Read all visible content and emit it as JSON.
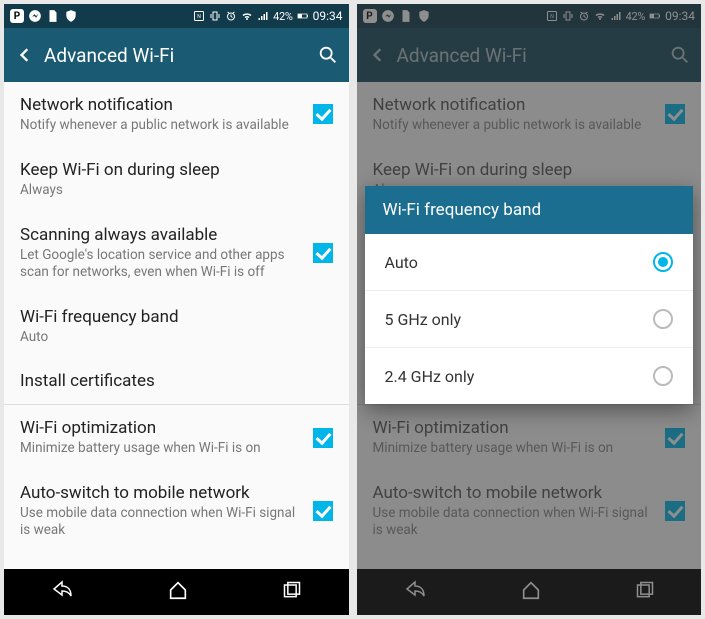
{
  "status": {
    "battery_pct": "42%",
    "time": "09:34"
  },
  "appbar": {
    "title": "Advanced Wi-Fi"
  },
  "settings": {
    "network_notification": {
      "title": "Network notification",
      "sub": "Notify whenever a public network is available"
    },
    "keep_on_sleep": {
      "title": "Keep Wi-Fi on during sleep",
      "sub": "Always"
    },
    "scanning": {
      "title": "Scanning always available",
      "sub": "Let Google's location service and other apps scan for networks, even when Wi-Fi is off"
    },
    "freq_band": {
      "title": "Wi-Fi frequency band",
      "sub": "Auto"
    },
    "install_certs": {
      "title": "Install certificates"
    },
    "optimization": {
      "title": "Wi-Fi optimization",
      "sub": "Minimize battery usage when Wi-Fi is on"
    },
    "auto_switch": {
      "title": "Auto-switch to mobile network",
      "sub": "Use mobile data connection when Wi-Fi signal is weak"
    }
  },
  "dialog": {
    "title": "Wi-Fi frequency band",
    "options": {
      "auto": "Auto",
      "five": "5 GHz only",
      "two_four": "2.4 GHz only"
    }
  }
}
